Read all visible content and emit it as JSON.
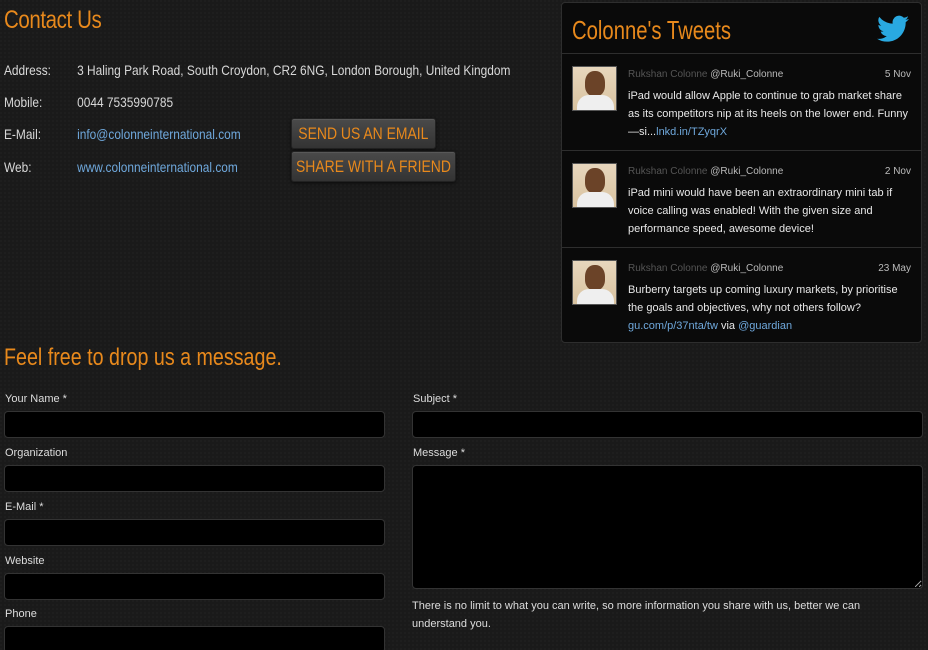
{
  "contact": {
    "title": "Contact Us",
    "address_label": "Address:",
    "address_value": "3 Haling Park Road, South Croydon, CR2 6NG, London Borough, United Kingdom",
    "mobile_label": "Mobile:",
    "mobile_value": "0044 7535990785",
    "email_label": "E-Mail:",
    "email_value": "info@colonneinternational.com",
    "web_label": "Web:",
    "web_value": "www.colonneinternational.com",
    "send_email_button": "SEND US AN EMAIL",
    "share_button": "SHARE WITH A FRIEND"
  },
  "tweets": {
    "title": "Colonne's Tweets",
    "items": [
      {
        "name": "Rukshan Colonne",
        "handle": "@Ruki_Colonne",
        "date": "5 Nov",
        "text": "iPad would allow Apple to continue to grab market share as its competitors nip at its heels on the lower end. Funny—si...",
        "link": "lnkd.in/TZyqrX",
        "suffix": ""
      },
      {
        "name": "Rukshan Colonne",
        "handle": "@Ruki_Colonne",
        "date": "2 Nov",
        "text": "iPad mini would have been an extraordinary mini tab if voice calling was enabled! With the given size and performance speed, awesome device!",
        "link": "",
        "suffix": ""
      },
      {
        "name": "Rukshan Colonne",
        "handle": "@Ruki_Colonne",
        "date": "23 May",
        "text": "Burberry targets up coming luxury markets, by prioritise the goals and objectives, why not others follow?",
        "link": "gu.com/p/37nta/tw",
        "suffix": " via ",
        "mention": "@guardian"
      }
    ]
  },
  "form": {
    "title": "Feel free to drop us a message.",
    "name_label": "Your Name *",
    "organization_label": "Organization",
    "email_label": "E-Mail *",
    "website_label": "Website",
    "phone_label": "Phone",
    "subject_label": "Subject *",
    "message_label": "Message *",
    "note": "There is no limit to what you can write, so more information you share with us, better we can understand you."
  },
  "colors": {
    "accent": "#e8891c",
    "link": "#6fa8dc",
    "background": "#1a1a1a"
  }
}
